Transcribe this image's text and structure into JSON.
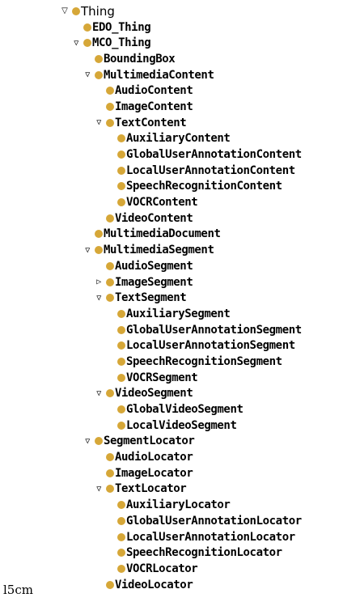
{
  "colors": {
    "class_dot": "#d6a738",
    "text": "#000000"
  },
  "icons": {
    "expanded": "triangle-down-icon",
    "collapsed": "triangle-right-icon",
    "class": "class-dot-icon"
  },
  "tree": [
    {
      "label": "Thing",
      "depth": 0,
      "state": "expanded"
    },
    {
      "label": "EDO_Thing",
      "depth": 1,
      "state": "leaf"
    },
    {
      "label": "MCO_Thing",
      "depth": 1,
      "state": "expanded"
    },
    {
      "label": "BoundingBox",
      "depth": 2,
      "state": "leaf"
    },
    {
      "label": "MultimediaContent",
      "depth": 2,
      "state": "expanded"
    },
    {
      "label": "AudioContent",
      "depth": 3,
      "state": "leaf"
    },
    {
      "label": "ImageContent",
      "depth": 3,
      "state": "leaf"
    },
    {
      "label": "TextContent",
      "depth": 3,
      "state": "expanded"
    },
    {
      "label": "AuxiliaryContent",
      "depth": 4,
      "state": "leaf"
    },
    {
      "label": "GlobalUserAnnotationContent",
      "depth": 4,
      "state": "leaf"
    },
    {
      "label": "LocalUserAnnotationContent",
      "depth": 4,
      "state": "leaf"
    },
    {
      "label": "SpeechRecognitionContent",
      "depth": 4,
      "state": "leaf"
    },
    {
      "label": "VOCRContent",
      "depth": 4,
      "state": "leaf"
    },
    {
      "label": "VideoContent",
      "depth": 3,
      "state": "leaf"
    },
    {
      "label": "MultimediaDocument",
      "depth": 2,
      "state": "leaf"
    },
    {
      "label": "MultimediaSegment",
      "depth": 2,
      "state": "expanded"
    },
    {
      "label": "AudioSegment",
      "depth": 3,
      "state": "leaf"
    },
    {
      "label": "ImageSegment",
      "depth": 3,
      "state": "collapsed"
    },
    {
      "label": "TextSegment",
      "depth": 3,
      "state": "expanded"
    },
    {
      "label": "AuxiliarySegment",
      "depth": 4,
      "state": "leaf"
    },
    {
      "label": "GlobalUserAnnotationSegment",
      "depth": 4,
      "state": "leaf"
    },
    {
      "label": "LocalUserAnnotationSegment",
      "depth": 4,
      "state": "leaf"
    },
    {
      "label": "SpeechRecognitionSegment",
      "depth": 4,
      "state": "leaf"
    },
    {
      "label": "VOCRSegment",
      "depth": 4,
      "state": "leaf"
    },
    {
      "label": "VideoSegment",
      "depth": 3,
      "state": "expanded"
    },
    {
      "label": "GlobalVideoSegment",
      "depth": 4,
      "state": "leaf"
    },
    {
      "label": "LocalVideoSegment",
      "depth": 4,
      "state": "leaf"
    },
    {
      "label": "SegmentLocator",
      "depth": 2,
      "state": "expanded"
    },
    {
      "label": "AudioLocator",
      "depth": 3,
      "state": "leaf"
    },
    {
      "label": "ImageLocator",
      "depth": 3,
      "state": "leaf"
    },
    {
      "label": "TextLocator",
      "depth": 3,
      "state": "expanded"
    },
    {
      "label": "AuxiliaryLocator",
      "depth": 4,
      "state": "leaf"
    },
    {
      "label": "GlobalUserAnnotationLocator",
      "depth": 4,
      "state": "leaf"
    },
    {
      "label": "LocalUserAnnotationLocator",
      "depth": 4,
      "state": "leaf"
    },
    {
      "label": "SpeechRecognitionLocator",
      "depth": 4,
      "state": "leaf"
    },
    {
      "label": "VOCRLocator",
      "depth": 4,
      "state": "leaf"
    },
    {
      "label": "VideoLocator",
      "depth": 3,
      "state": "leaf"
    }
  ],
  "footer": {
    "text": "l5cm"
  }
}
